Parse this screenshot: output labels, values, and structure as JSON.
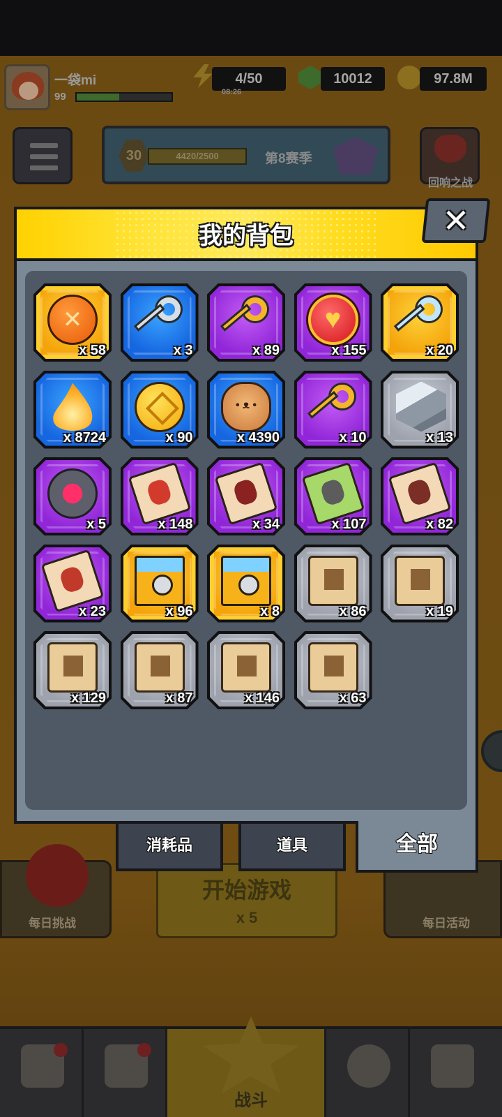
{
  "player": {
    "name": "一袋mi",
    "level": "99",
    "xp_fill": 0.45
  },
  "resources": {
    "energy": "4/50",
    "energy_timer": "08:26",
    "gems": "10012",
    "gold": "97.8M"
  },
  "season": {
    "level": "30",
    "xp": "4420/2500",
    "name": "第8赛季"
  },
  "echo_battle": {
    "label": "回响之战"
  },
  "bag": {
    "title": "我的背包",
    "close_label": "✕",
    "items": [
      {
        "icon": "gene-orb-icon",
        "rarity": "gold",
        "qty": "x 58"
      },
      {
        "icon": "silver-key-icon",
        "rarity": "blue",
        "qty": "x 3"
      },
      {
        "icon": "gold-key-icon",
        "rarity": "purple",
        "qty": "x 89"
      },
      {
        "icon": "heart-orb-icon",
        "rarity": "purple",
        "qty": "x 155"
      },
      {
        "icon": "crystal-key-icon",
        "rarity": "gold",
        "qty": "x 20"
      },
      {
        "icon": "flame-essence-icon",
        "rarity": "blue",
        "qty": "x 8724"
      },
      {
        "icon": "gold-coin-icon",
        "rarity": "blue",
        "qty": "x 90"
      },
      {
        "icon": "pet-cookie-icon",
        "rarity": "blue",
        "qty": "x 4390"
      },
      {
        "icon": "pet-key-icon",
        "rarity": "purple",
        "qty": "x 10"
      },
      {
        "icon": "metal-cube-icon",
        "rarity": "gray",
        "qty": "x 13"
      },
      {
        "icon": "gem-socket-icon",
        "rarity": "purple",
        "qty": "x 5"
      },
      {
        "icon": "character-puzzle-icon",
        "rarity": "purple",
        "qty": "x 148"
      },
      {
        "icon": "character-puzzle-icon",
        "rarity": "purple",
        "qty": "x 34"
      },
      {
        "icon": "character-puzzle-icon",
        "rarity": "purple",
        "qty": "x 107"
      },
      {
        "icon": "character-puzzle-icon",
        "rarity": "purple",
        "qty": "x 82"
      },
      {
        "icon": "character-puzzle-icon",
        "rarity": "purple",
        "qty": "x 23"
      },
      {
        "icon": "treasure-chest-icon",
        "rarity": "gold",
        "qty": "x 96"
      },
      {
        "icon": "treasure-chest-icon",
        "rarity": "gold",
        "qty": "x 8"
      },
      {
        "icon": "weapon-scroll-icon",
        "rarity": "gray",
        "qty": "x 86"
      },
      {
        "icon": "armor-scroll-icon",
        "rarity": "gray",
        "qty": "x 19"
      },
      {
        "icon": "necklace-scroll-icon",
        "rarity": "gray",
        "qty": "x 129"
      },
      {
        "icon": "belt-scroll-icon",
        "rarity": "gray",
        "qty": "x 87"
      },
      {
        "icon": "glove-scroll-icon",
        "rarity": "gray",
        "qty": "x 146"
      },
      {
        "icon": "boots-scroll-icon",
        "rarity": "gray",
        "qty": "x 63"
      }
    ],
    "tabs": [
      {
        "label": "消耗品",
        "active": false
      },
      {
        "label": "道具",
        "active": false
      },
      {
        "label": "全部",
        "active": true
      }
    ]
  },
  "lobby": {
    "daily_challenge": "每日挑战",
    "start_game": "开始游戏",
    "start_cost": "x 5",
    "daily_event": "每日活动",
    "battle": "战斗"
  },
  "colors": {
    "header_yellow": "#ffd200",
    "modal_gray": "#7b8896",
    "rarity_gold": "#f4a40a",
    "rarity_blue": "#1666e0",
    "rarity_purple": "#9126d8",
    "rarity_gray": "#9da2ad"
  }
}
